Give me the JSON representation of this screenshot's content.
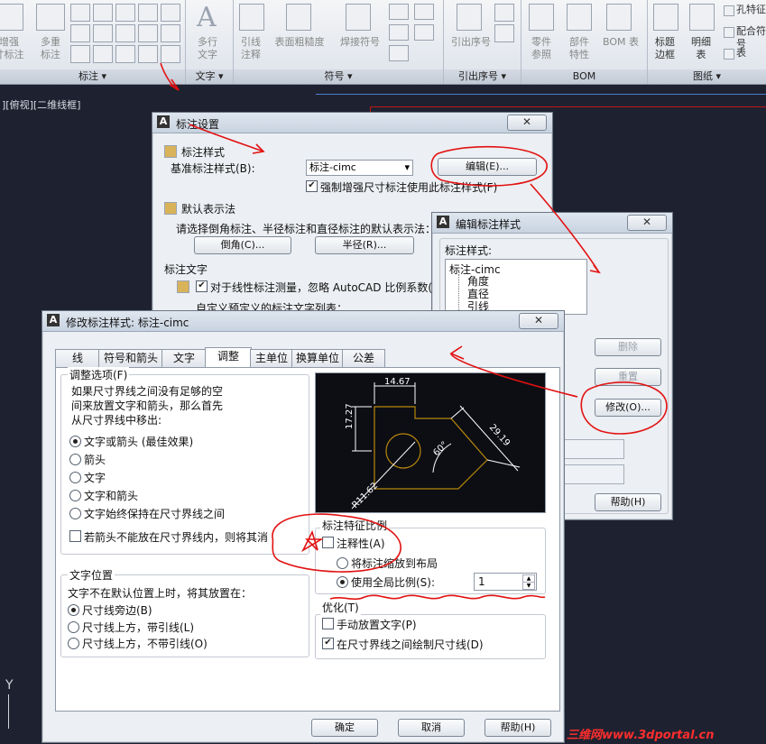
{
  "ribbon": {
    "panels": [
      {
        "title": "标注",
        "buttons": [
          "增强\n寸标注",
          "多重\n标注"
        ]
      },
      {
        "title": "文字",
        "buttons": [
          "多行\n文字"
        ]
      },
      {
        "title": "符号",
        "buttons": [
          "引线\n注释",
          "表面粗糙度",
          "焊接符号"
        ]
      },
      {
        "title": "引出序号",
        "buttons": [
          "引出序号"
        ]
      },
      {
        "title": "BOM",
        "buttons": [
          "零件\n参照",
          "部件\n特性",
          "BOM 表"
        ]
      },
      {
        "title": "图纸",
        "buttons": [
          "标题\n边框",
          "明细\n表",
          "孔特征",
          "配合符号",
          "表"
        ]
      }
    ]
  },
  "viewport": {
    "label": "][俯视][二维线框]",
    "axis_y": "Y"
  },
  "dialog_settings": {
    "title": "标注设置",
    "close": "✕",
    "sec_style": "标注样式",
    "base_label": "基准标注样式(B):",
    "base_value": "标注-cimc",
    "edit_btn": "编辑(E)...",
    "force_label": "强制增强尺寸标注使用此标注样式(F)",
    "sec_default": "默认表示法",
    "default_desc": "请选择倒角标注、半径标注和直径标注的默认表示法：",
    "chamfer_btn": "倒角(C)...",
    "radius_btn": "半径(R)...",
    "sec_text": "标注文字",
    "ignore_label": "对于线性标注测量，忽略 AutoCAD 比例系数(N",
    "custom_label": "自定义预定义的标注文字列表："
  },
  "dialog_edit": {
    "title": "编辑标注样式",
    "close": "✕",
    "list_label": "标注样式:",
    "tree": [
      "标注-cimc",
      "角度",
      "直径",
      "引线",
      "坐标"
    ],
    "delete_btn": "删除",
    "reset_btn": "重置",
    "modify_btn": "修改(O)...",
    "help_btn": "帮助(H)"
  },
  "dialog_modify": {
    "title": "修改标注样式: 标注-cimc",
    "close": "✕",
    "tabs": [
      "线",
      "符号和箭头",
      "文字",
      "调整",
      "主单位",
      "换算单位",
      "公差"
    ],
    "active_tab": "调整",
    "fit_group": "调整选项(F)",
    "fit_desc": [
      "如果尺寸界线之间没有足够的空",
      "间来放置文字和箭头，那么首先",
      "从尺寸界线中移出:"
    ],
    "fit_options": [
      "文字或箭头 (最佳效果)",
      "箭头",
      "文字",
      "文字和箭头",
      "文字始终保持在尺寸界线之间"
    ],
    "fit_selected": 0,
    "suppress_label": "若箭头不能放在尺寸界线内，则将其消",
    "textpos_group": "文字位置",
    "textpos_desc": "文字不在默认位置上时，将其放置在：",
    "textpos_options": [
      "尺寸线旁边(B)",
      "尺寸线上方，带引线(L)",
      "尺寸线上方，不带引线(O)"
    ],
    "textpos_selected": 0,
    "scale_group": "标注特征比例",
    "annotative_label": "注释性(A)",
    "scale_layout_label": "将标注缩放到布局",
    "global_scale_label": "使用全局比例(S):",
    "global_scale_value": "1",
    "opt_group": "优化(T)",
    "manual_label": "手动放置文字(P)",
    "draw_between_label": "在尺寸界线之间绘制尺寸线(D)",
    "ok_btn": "确定",
    "cancel_btn": "取消",
    "help_btn": "帮助(H)"
  },
  "preview": {
    "dim_top": "14.67",
    "dim_left": "17.27",
    "dim_right": "29.19",
    "angle": "60°",
    "radius": "R11.62"
  },
  "watermark": "三维网www.3dportal.cn",
  "colors": {
    "annotation": "#e21111",
    "preview_bg": "#0c0e14",
    "preview_line": "#b8860b"
  }
}
